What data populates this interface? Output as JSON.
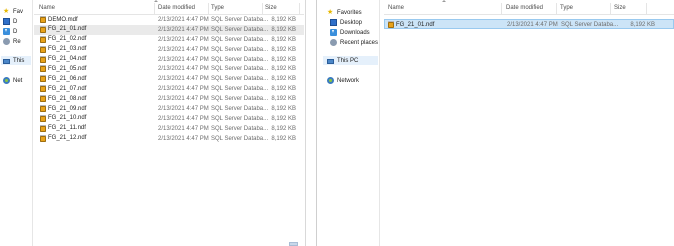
{
  "left": {
    "nav": {
      "favorites": "Fav",
      "item_d1": "D",
      "item_d2": "D",
      "item_re": "Re",
      "this_pc": "This",
      "network": "Net"
    },
    "columns": {
      "name": "Name",
      "date": "Date modified",
      "type": "Type",
      "size": "Size"
    },
    "files": [
      {
        "name": "DEMO.mdf",
        "date": "2/13/2021 4:47 PM",
        "type": "SQL Server Databa...",
        "size": "8,192 KB"
      },
      {
        "name": "FG_21_01.ndf",
        "date": "2/13/2021 4:47 PM",
        "type": "SQL Server Databa...",
        "size": "8,192 KB"
      },
      {
        "name": "FG_21_02.ndf",
        "date": "2/13/2021 4:47 PM",
        "type": "SQL Server Databa...",
        "size": "8,192 KB"
      },
      {
        "name": "FG_21_03.ndf",
        "date": "2/13/2021 4:47 PM",
        "type": "SQL Server Databa...",
        "size": "8,192 KB"
      },
      {
        "name": "FG_21_04.ndf",
        "date": "2/13/2021 4:47 PM",
        "type": "SQL Server Databa...",
        "size": "8,192 KB"
      },
      {
        "name": "FG_21_05.ndf",
        "date": "2/13/2021 4:47 PM",
        "type": "SQL Server Databa...",
        "size": "8,192 KB"
      },
      {
        "name": "FG_21_06.ndf",
        "date": "2/13/2021 4:47 PM",
        "type": "SQL Server Databa...",
        "size": "8,192 KB"
      },
      {
        "name": "FG_21_07.ndf",
        "date": "2/13/2021 4:47 PM",
        "type": "SQL Server Databa...",
        "size": "8,192 KB"
      },
      {
        "name": "FG_21_08.ndf",
        "date": "2/13/2021 4:47 PM",
        "type": "SQL Server Databa...",
        "size": "8,192 KB"
      },
      {
        "name": "FG_21_09.ndf",
        "date": "2/13/2021 4:47 PM",
        "type": "SQL Server Databa...",
        "size": "8,192 KB"
      },
      {
        "name": "FG_21_10.ndf",
        "date": "2/13/2021 4:47 PM",
        "type": "SQL Server Databa...",
        "size": "8,192 KB"
      },
      {
        "name": "FG_21_11.ndf",
        "date": "2/13/2021 4:47 PM",
        "type": "SQL Server Databa...",
        "size": "8,192 KB"
      },
      {
        "name": "FG_21_12.ndf",
        "date": "2/13/2021 4:47 PM",
        "type": "SQL Server Databa...",
        "size": "8,192 KB"
      }
    ]
  },
  "right": {
    "nav": {
      "favorites": "Favorites",
      "desktop": "Desktop",
      "downloads": "Downloads",
      "recent": "Recent places",
      "this_pc": "This PC",
      "network": "Network"
    },
    "columns": {
      "name": "Name",
      "date": "Date modified",
      "type": "Type",
      "size": "Size"
    },
    "files": [
      {
        "name": "FG_21_01.ndf",
        "date": "2/13/2021 4:47 PM",
        "type": "SQL Server Databa...",
        "size": "8,192 KB"
      }
    ]
  },
  "colors": {
    "selection": "#cce4f7",
    "selection_border": "#99c9ef",
    "hover": "#eaeaea",
    "folder_accent": "#e8a21a"
  }
}
